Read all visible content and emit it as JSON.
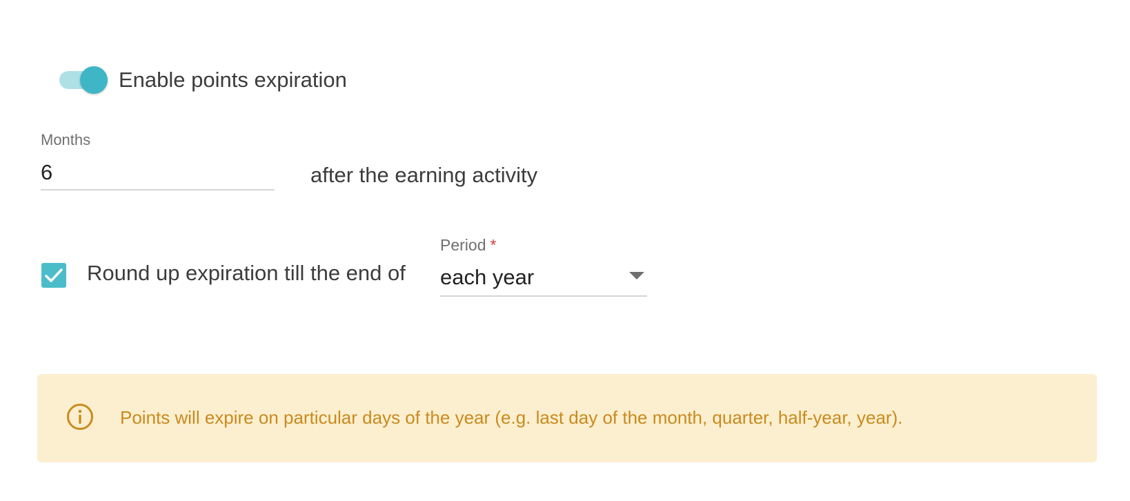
{
  "expiration_toggle": {
    "label": "Enable points expiration",
    "enabled": true
  },
  "months": {
    "label": "Months",
    "value": "6",
    "suffix": "after the earning activity"
  },
  "round_up": {
    "checked": true,
    "label": "Round up expiration till the end of"
  },
  "period": {
    "label": "Period",
    "required_mark": "*",
    "selected": "each year"
  },
  "info_banner": {
    "icon": "info-icon",
    "text": "Points will expire on particular days of the year (e.g. last day of the month, quarter, half-year, year)."
  },
  "colors": {
    "accent": "#3fb6c5",
    "accent_light": "#aee0e6",
    "checkbox": "#4bbdca",
    "banner_bg": "#fcefcf",
    "banner_text": "#c98a1e",
    "required": "#d23f3f"
  }
}
